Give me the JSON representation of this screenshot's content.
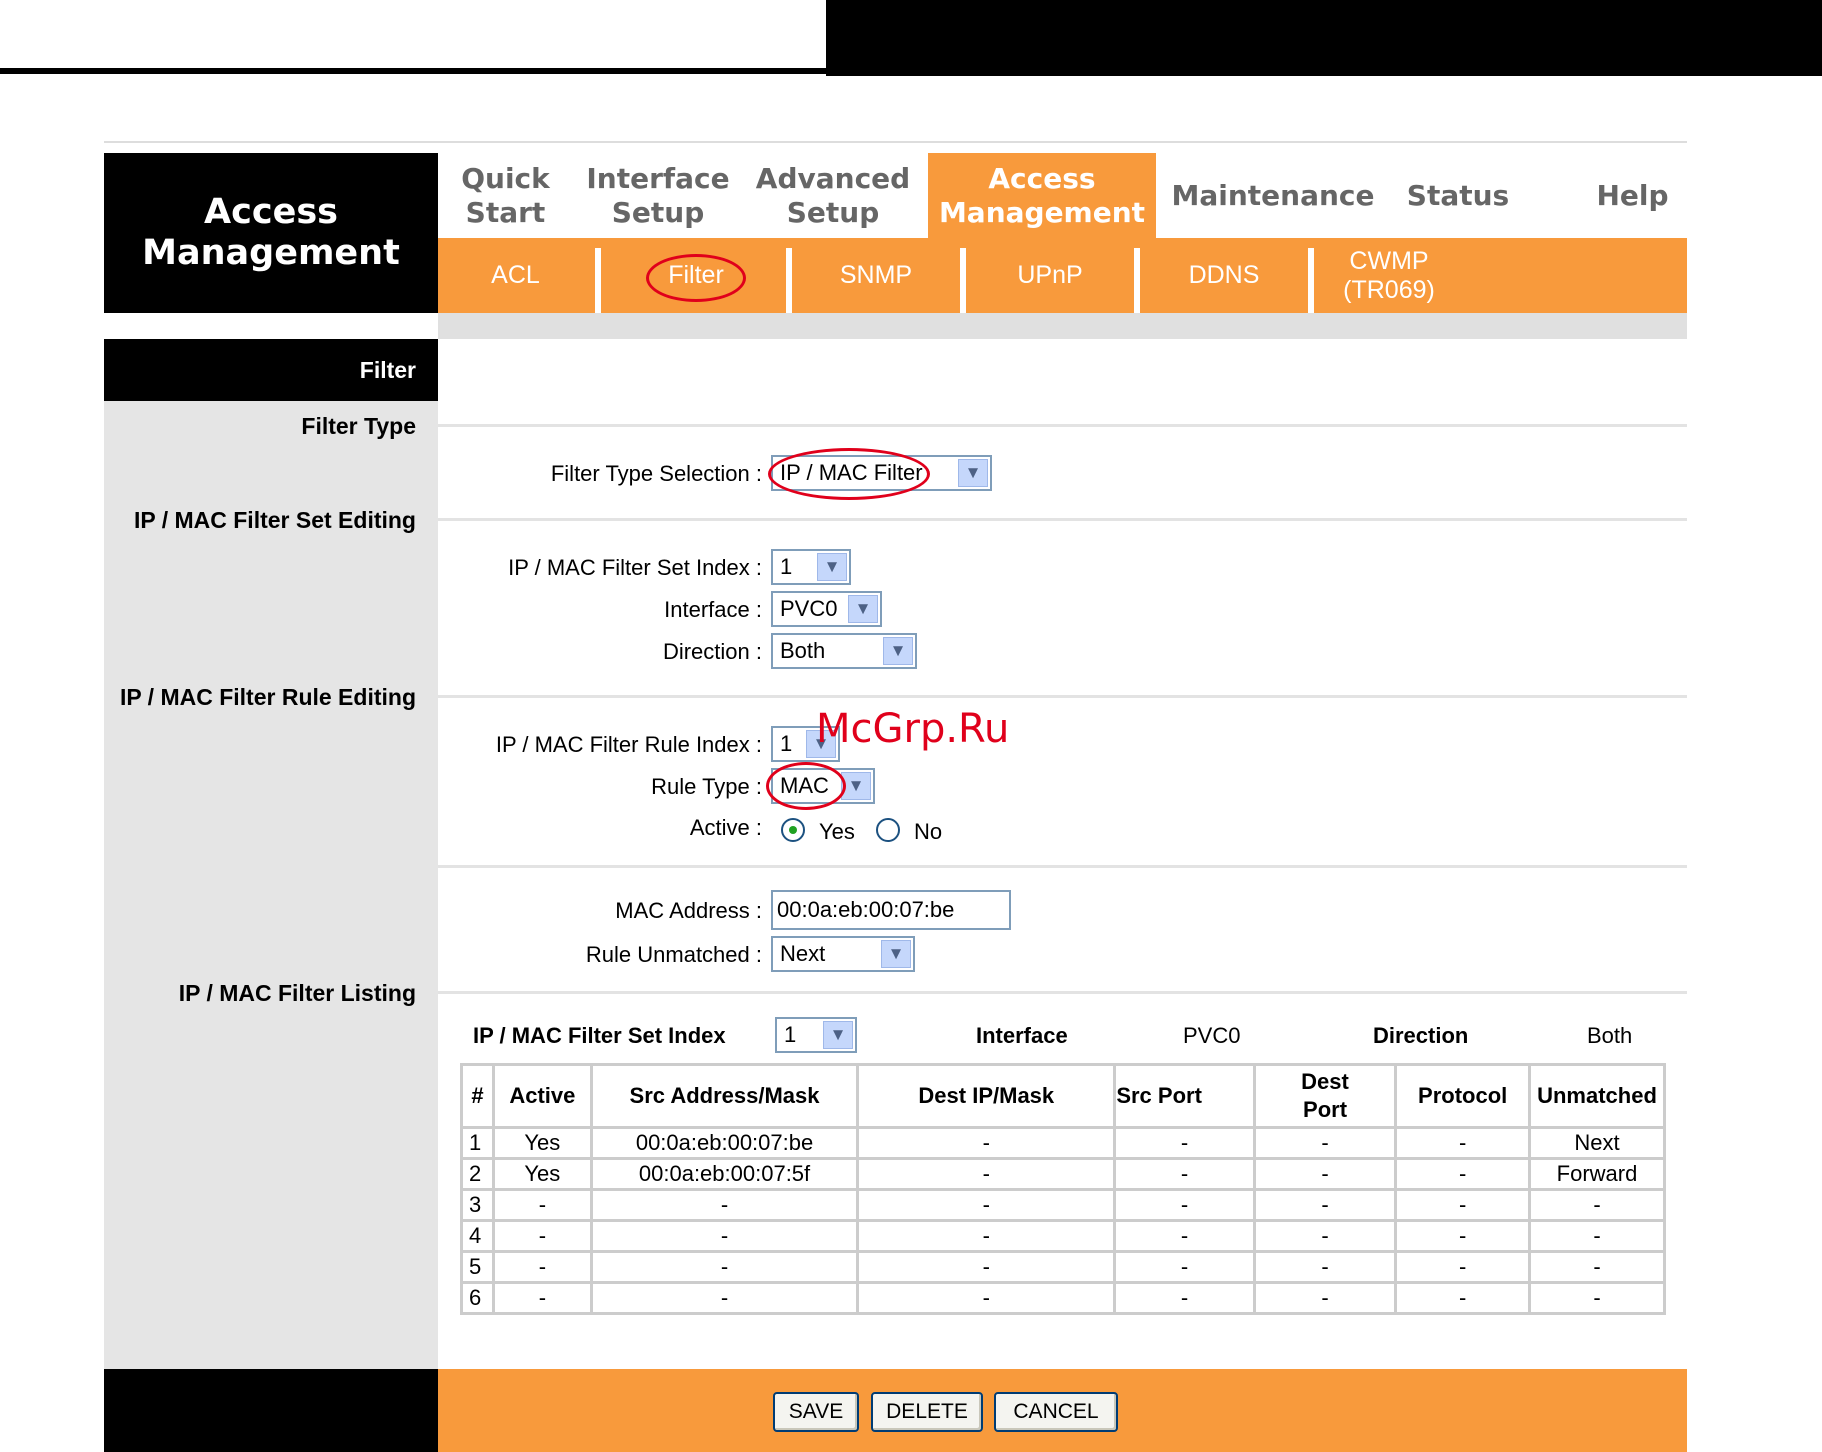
{
  "brand": {
    "line1": "Access",
    "line2": "Management"
  },
  "main_nav": [
    {
      "line1": "Quick",
      "line2": "Start"
    },
    {
      "line1": "Interface",
      "line2": "Setup"
    },
    {
      "line1": "Advanced",
      "line2": "Setup"
    },
    {
      "line1": "Access",
      "line2": "Management"
    },
    {
      "line1": "Maintenance",
      "line2": ""
    },
    {
      "line1": "Status",
      "line2": ""
    },
    {
      "line1": "Help",
      "line2": ""
    }
  ],
  "sub_nav": [
    {
      "line1": "ACL",
      "line2": ""
    },
    {
      "line1": "Filter",
      "line2": ""
    },
    {
      "line1": "SNMP",
      "line2": ""
    },
    {
      "line1": "UPnP",
      "line2": ""
    },
    {
      "line1": "DDNS",
      "line2": ""
    },
    {
      "line1": "CWMP",
      "line2": "(TR069)"
    }
  ],
  "colors": {
    "accent": "#f89a3c",
    "highlight": "#e0001b"
  },
  "page_heading": "Filter",
  "sections": {
    "filter_type": "Filter Type",
    "set_editing": "IP / MAC Filter Set Editing",
    "rule_editing": "IP / MAC Filter Rule Editing",
    "listing": "IP / MAC Filter Listing"
  },
  "form": {
    "filter_type_label": "Filter Type Selection :",
    "filter_type_value": "IP / MAC Filter",
    "set_index_label": "IP / MAC Filter Set Index :",
    "set_index_value": "1",
    "interface_label": "Interface :",
    "interface_value": "PVC0",
    "direction_label": "Direction :",
    "direction_value": "Both",
    "rule_index_label": "IP / MAC Filter Rule Index :",
    "rule_index_value": "1",
    "rule_type_label": "Rule Type :",
    "rule_type_value": "MAC",
    "active_label": "Active :",
    "active_yes": "Yes",
    "active_no": "No",
    "active_selected": "Yes",
    "mac_label": "MAC Address :",
    "mac_value": "00:0a:eb:00:07:be",
    "unmatched_label": "Rule Unmatched :",
    "unmatched_value": "Next"
  },
  "listing": {
    "set_index_label": "IP / MAC Filter Set Index",
    "set_index_value": "1",
    "interface_label": "Interface",
    "interface_value": "PVC0",
    "direction_label": "Direction",
    "direction_value": "Both",
    "columns": [
      "#",
      "Active",
      "Src Address/Mask",
      "Dest IP/Mask",
      "Src Port",
      "Dest\nPort",
      "Protocol",
      "Unmatched"
    ],
    "rows": [
      [
        "1",
        "Yes",
        "00:0a:eb:00:07:be",
        "-",
        "-",
        "-",
        "-",
        "Next"
      ],
      [
        "2",
        "Yes",
        "00:0a:eb:00:07:5f",
        "-",
        "-",
        "-",
        "-",
        "Forward"
      ],
      [
        "3",
        "-",
        "-",
        "-",
        "-",
        "-",
        "-",
        "-"
      ],
      [
        "4",
        "-",
        "-",
        "-",
        "-",
        "-",
        "-",
        "-"
      ],
      [
        "5",
        "-",
        "-",
        "-",
        "-",
        "-",
        "-",
        "-"
      ],
      [
        "6",
        "-",
        "-",
        "-",
        "-",
        "-",
        "-",
        "-"
      ]
    ]
  },
  "buttons": {
    "save": "SAVE",
    "delete": "DELETE",
    "cancel": "CANCEL"
  },
  "watermark": "McGrp.Ru"
}
